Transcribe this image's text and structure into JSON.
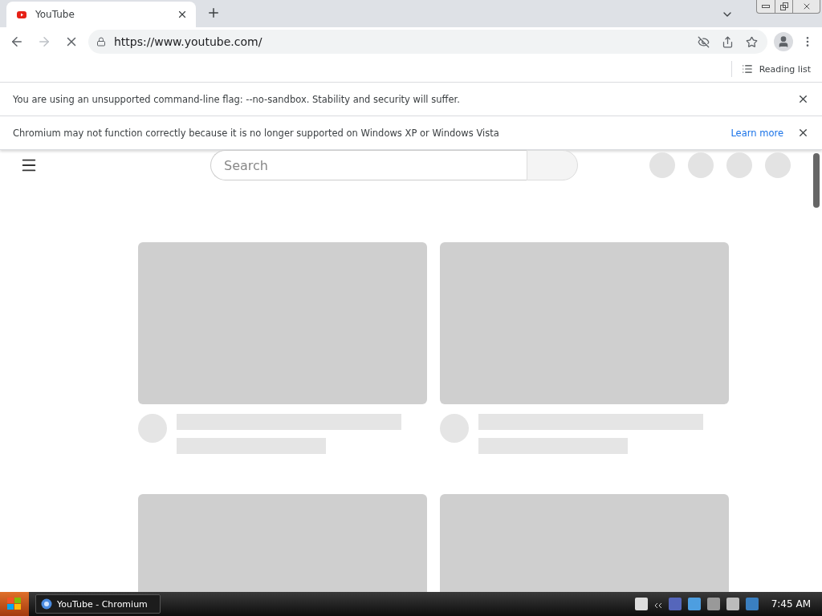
{
  "tab": {
    "title": "YouTube",
    "selected": true
  },
  "toolbar": {
    "url": "https://www.youtube.com/",
    "loading": true,
    "forward_disabled": true
  },
  "bookmarks_bar": {
    "reading_list": "Reading list"
  },
  "infobars": [
    {
      "text": "You are using an unsupported command-line flag: --no-sandbox. Stability and security will suffer."
    },
    {
      "text": "Chromium may not function correctly because it is no longer supported on Windows XP or Windows Vista",
      "link": "Learn more"
    }
  ],
  "page": {
    "search": {
      "placeholder": "Search"
    }
  },
  "taskbar": {
    "window_button": "YouTube - Chromium",
    "clock": "7:45 AM"
  }
}
